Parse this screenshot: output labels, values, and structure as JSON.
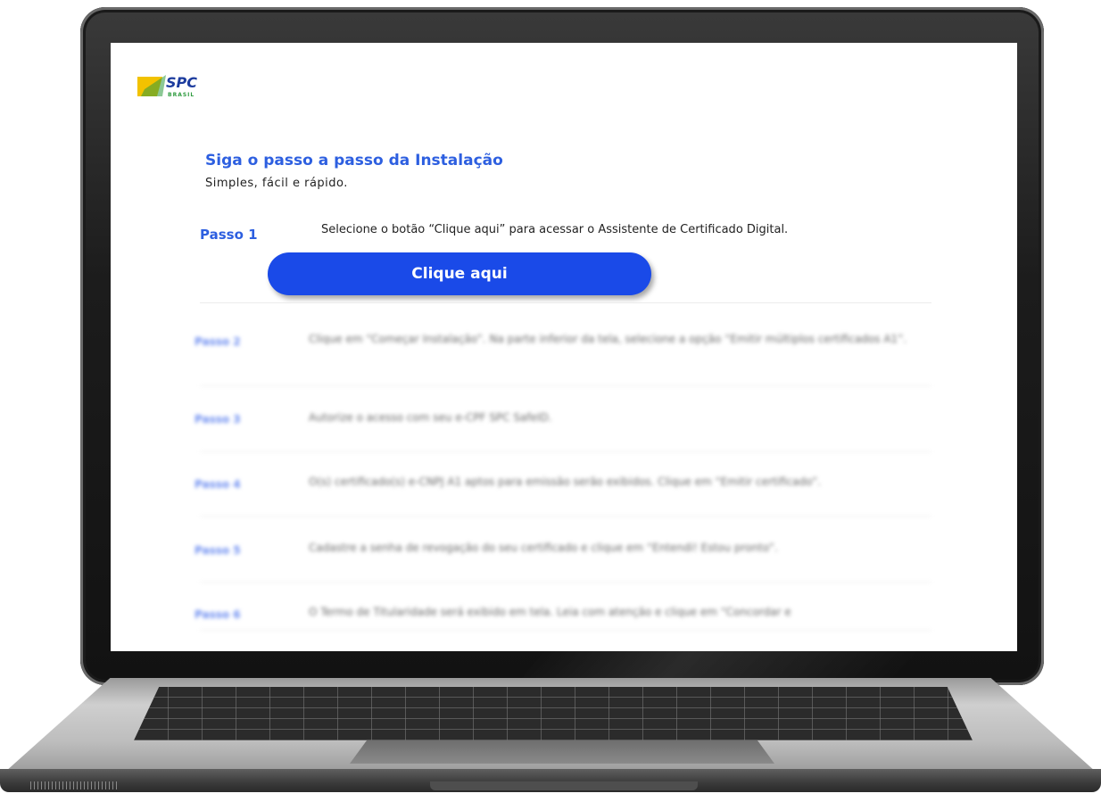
{
  "page": {
    "title": "Siga o passo a passo da Instalação",
    "subtitle": "Simples, fácil e rápido."
  },
  "logo": {
    "name": "SPC",
    "sub": "BRASIL"
  },
  "steps": [
    {
      "label": "Passo 1",
      "text": "Selecione o botão “Clique aqui” para acessar o Assistente de Certificado Digital.",
      "button_label": "Clique aqui"
    },
    {
      "label": "Passo 2",
      "text": "Clique em “Começar Instalação”. Na parte inferior da tela, selecione a opção “Emitir múltiplos certificados A1”."
    },
    {
      "label": "Passo 3",
      "text": "Autorize o acesso com seu e-CPF SPC SafeID."
    },
    {
      "label": "Passo 4",
      "text": "O(s) certificado(s) e-CNPJ A1 aptos para emissão serão exibidos. Clique em “Emitir certificado”."
    },
    {
      "label": "Passo 5",
      "text": "Cadastre a senha de revogação do seu certificado e clique em “Entendi! Estou pronto”."
    },
    {
      "label": "Passo 6",
      "text": "O Termo de Titularidade será exibido em tela. Leia com atenção e clique em “Concordar e"
    }
  ],
  "colors": {
    "accent": "#2d5fe0",
    "button": "#1a4ae8",
    "logo_yellow": "#f2c200",
    "logo_green": "#2e9b3e",
    "logo_blue": "#1d3c9e"
  }
}
